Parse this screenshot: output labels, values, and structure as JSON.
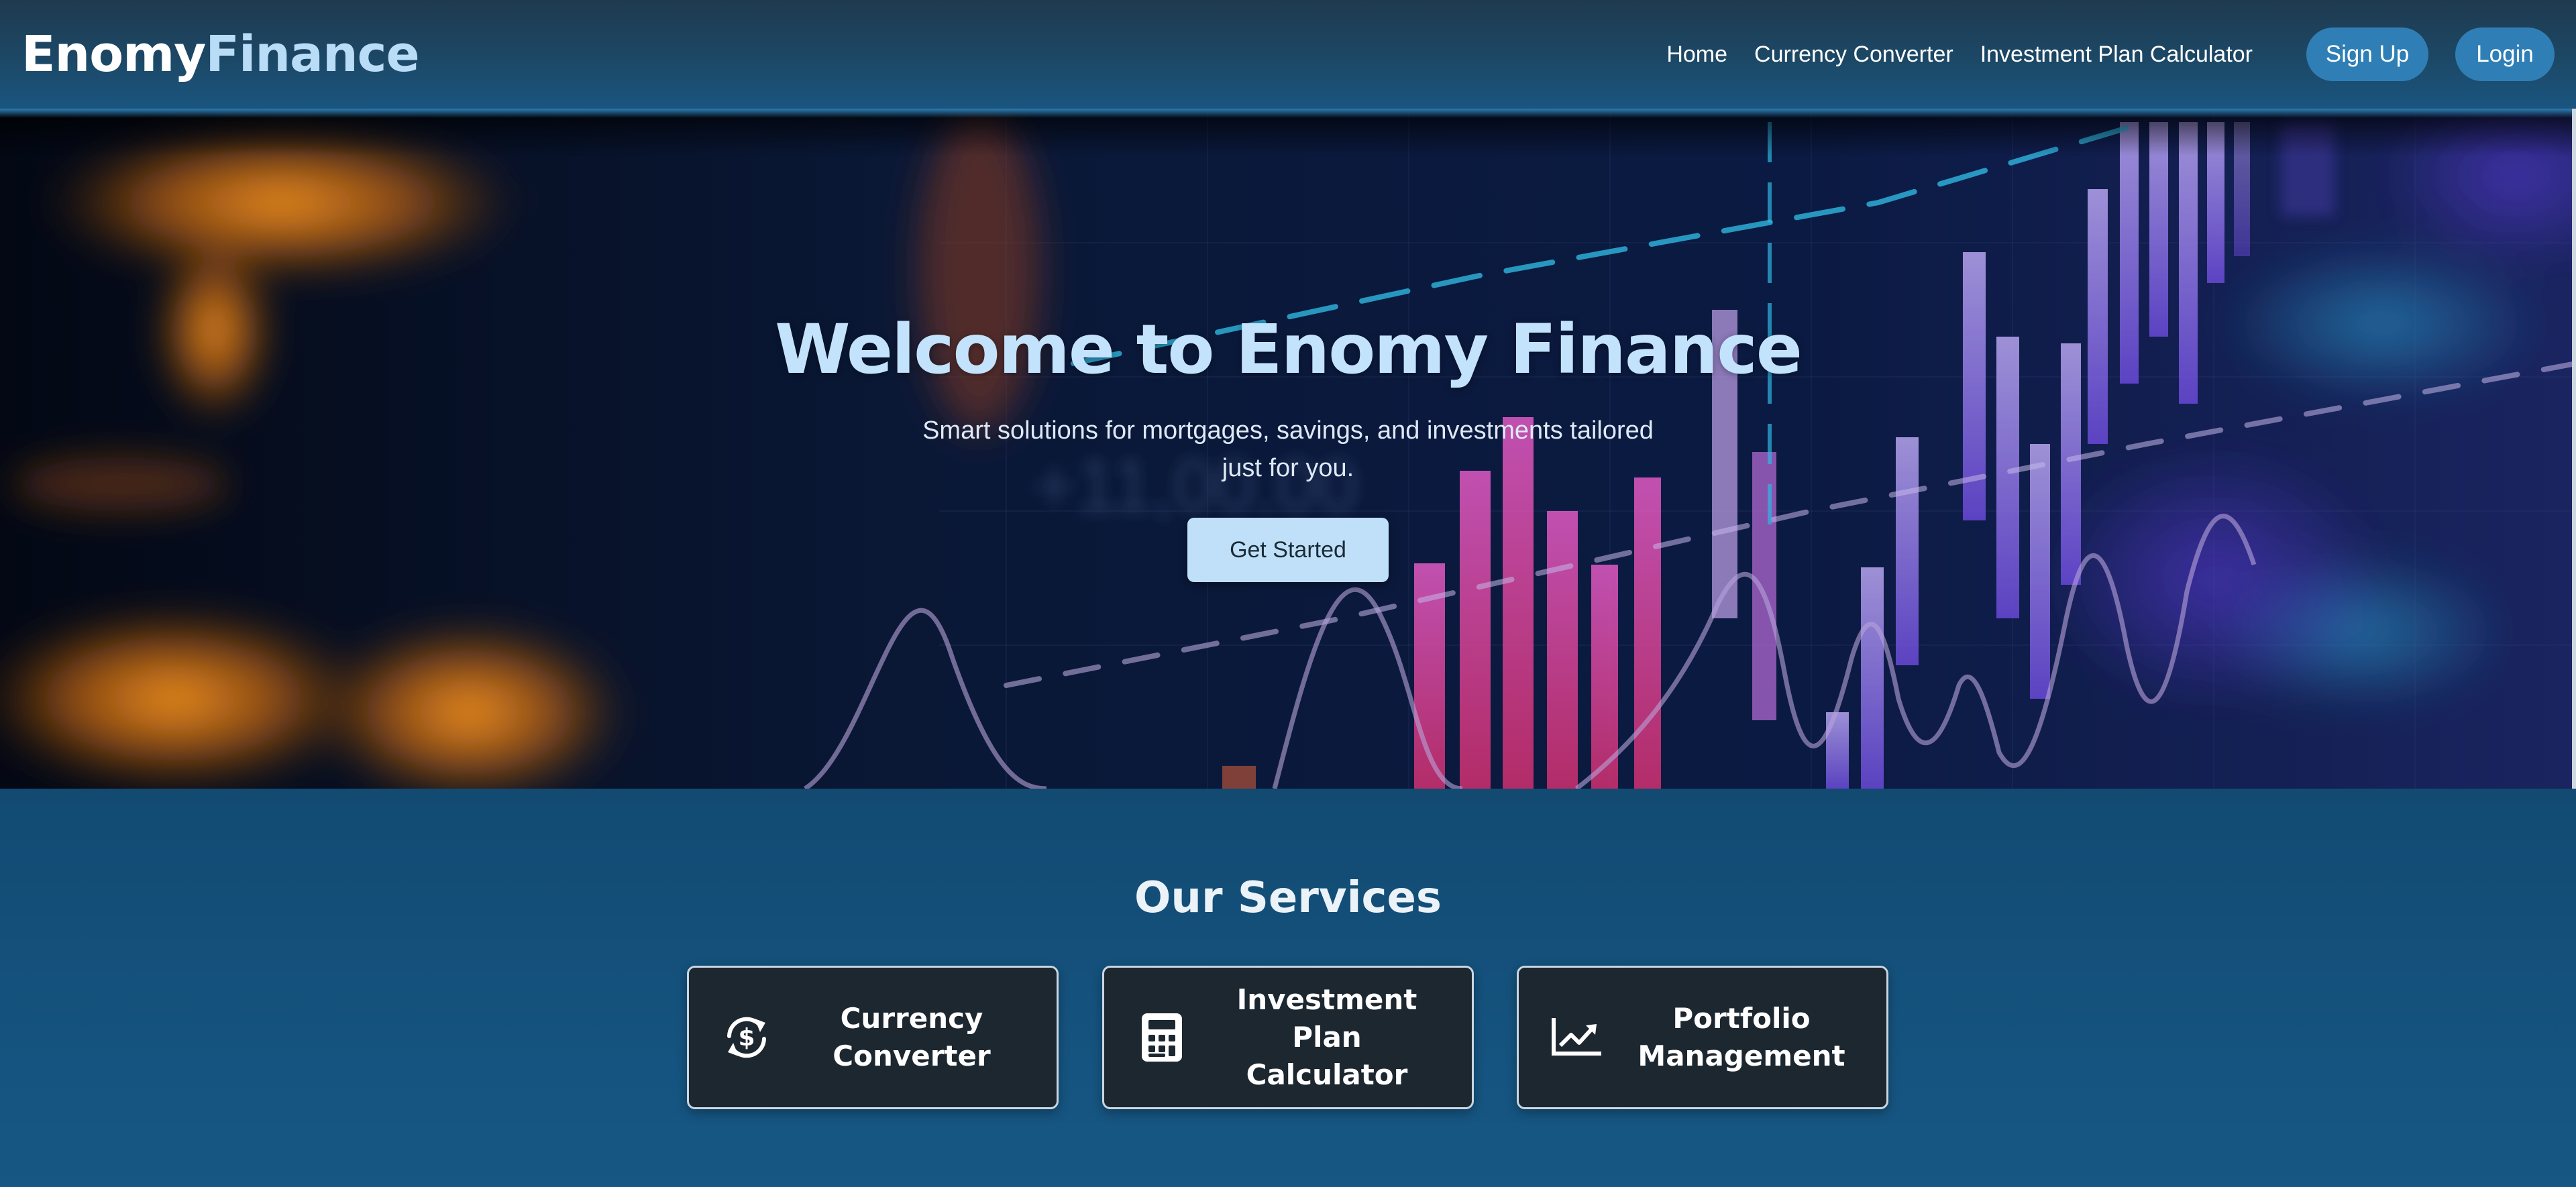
{
  "header": {
    "logo_part1": "Enomy",
    "logo_part2": "Finance",
    "nav": {
      "home": "Home",
      "currency_converter": "Currency Converter",
      "investment_plan_calculator": "Investment Plan Calculator"
    },
    "signup_label": "Sign Up",
    "login_label": "Login"
  },
  "hero": {
    "title": "Welcome to Enomy Finance",
    "subtitle": "Smart solutions for mortgages, savings, and investments tailored just for you.",
    "cta_label": "Get Started",
    "background_text": "+11,00.00"
  },
  "services": {
    "title": "Our Services",
    "cards": [
      {
        "label": "Currency\nConverter",
        "icon": "currency-exchange-icon"
      },
      {
        "label": "Investment Plan\nCalculator",
        "icon": "calculator-icon"
      },
      {
        "label": "Portfolio\nManagement",
        "icon": "chart-line-icon"
      }
    ]
  },
  "colors": {
    "accent": "#2f7fb6",
    "hero_title": "#c3e2fb",
    "cta_bg": "#bfe0f8",
    "card_bg": "#1d2730",
    "services_bg": "#124a72"
  }
}
